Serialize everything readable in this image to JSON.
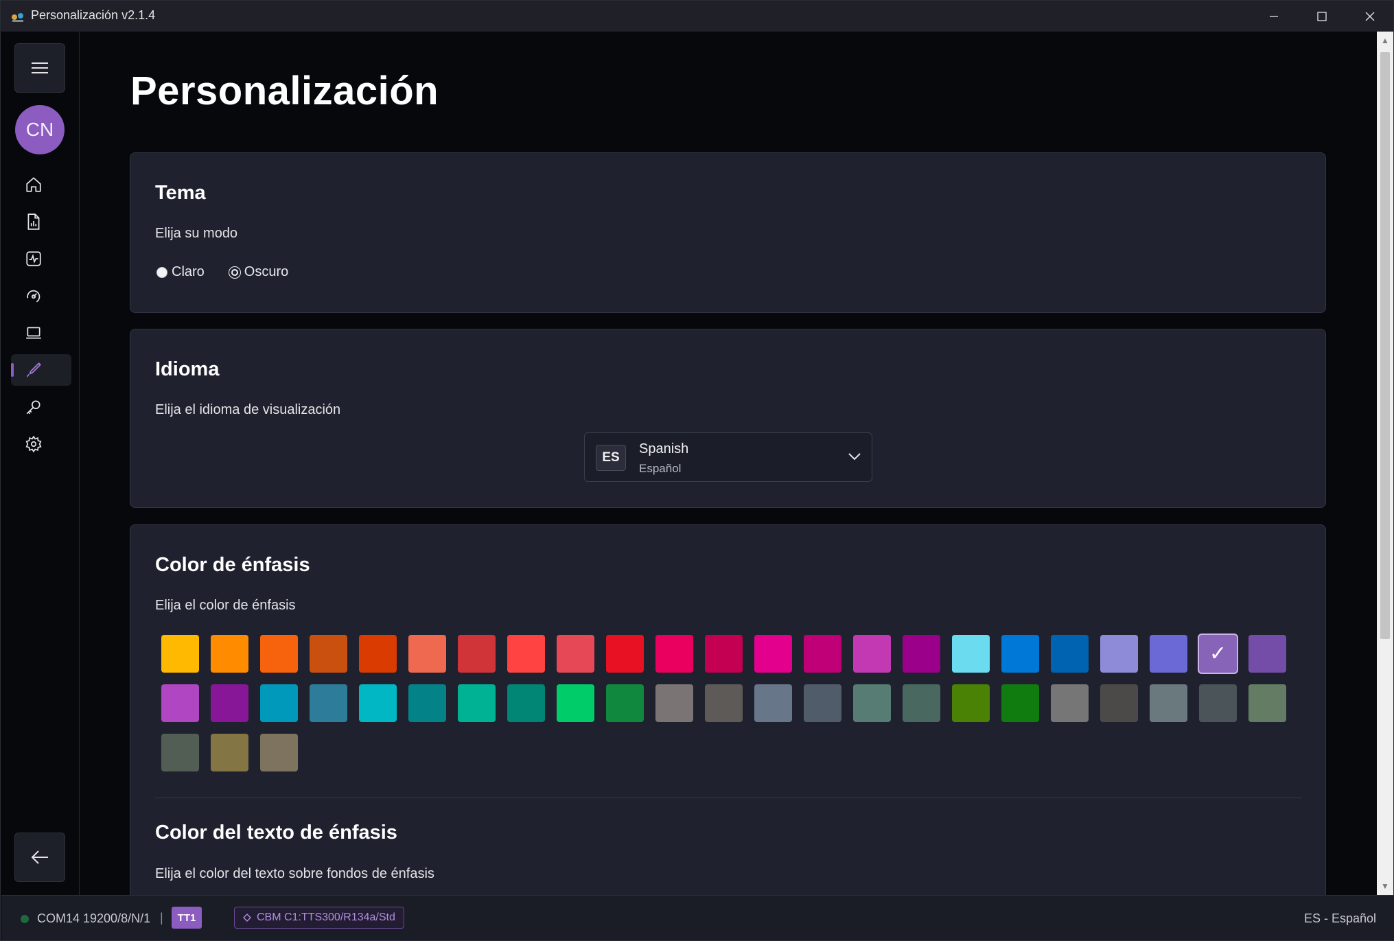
{
  "window": {
    "title": "Personalización v2.1.4"
  },
  "sidebar": {
    "avatar_initials": "CN",
    "nav_icons": [
      "home-icon",
      "report-icon",
      "activity-icon",
      "gauge-icon",
      "laptop-icon",
      "brush-icon",
      "key-icon",
      "gear-icon"
    ],
    "active_index": 5
  },
  "page": {
    "title": "Personalización"
  },
  "theme_card": {
    "title": "Tema",
    "subtitle": "Elija su modo",
    "options": [
      {
        "label": "Claro",
        "checked": false
      },
      {
        "label": "Oscuro",
        "checked": true
      }
    ]
  },
  "language_card": {
    "title": "Idioma",
    "subtitle": "Elija el idioma de visualización",
    "selected": {
      "code": "ES",
      "name": "Spanish",
      "native": "Español"
    }
  },
  "accent_card": {
    "title": "Color de énfasis",
    "subtitle": "Elija el color de énfasis",
    "selected_index": 21,
    "selected_mark": "✓",
    "colors": [
      "#ffb900",
      "#ff8c00",
      "#f7630c",
      "#ca5010",
      "#da3b01",
      "#ef6950",
      "#d13438",
      "#ff4343",
      "#e74856",
      "#e81123",
      "#ea005e",
      "#c30052",
      "#e3008c",
      "#bf0077",
      "#c239b3",
      "#9a0089",
      "#6bdcf0",
      "#0078d7",
      "#0063b1",
      "#8e8cd8",
      "#6b69d6",
      "#8764b8",
      "#744da9",
      "#b146c2",
      "#881798",
      "#0099bc",
      "#2d7d9a",
      "#00b7c3",
      "#038387",
      "#00b294",
      "#018574",
      "#00cc6a",
      "#10893e",
      "#7a7574",
      "#5d5a58",
      "#68768a",
      "#515c6b",
      "#567c73",
      "#486860",
      "#498205",
      "#107c10",
      "#767676",
      "#4c4a48",
      "#69797e",
      "#4a5459",
      "#647c64",
      "#525e54",
      "#847545",
      "#7e735f"
    ]
  },
  "accent_text_card": {
    "title": "Color del texto de énfasis",
    "subtitle": "Elija el color del texto sobre fondos de énfasis"
  },
  "statusbar": {
    "port": "COM14 19200/8/N/1",
    "separator": "|",
    "tt_badge": "TT1",
    "cbm": "CBM C1:TTS300/R134a/Std",
    "cbm_icon": "diamond-icon",
    "language": "ES - Español"
  }
}
